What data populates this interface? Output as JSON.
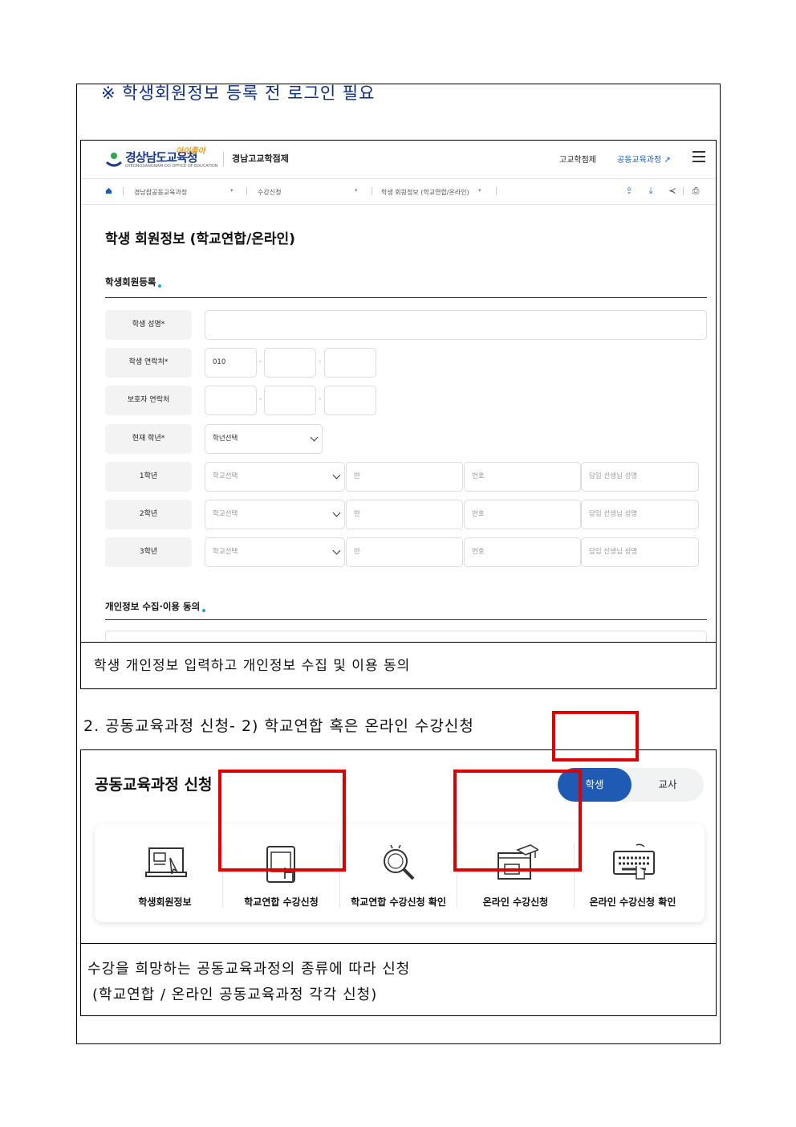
{
  "notice": "※ 학생회원정보 등록 전 로그인 필요",
  "screenshot1": {
    "logo_text": "경상남도교육청",
    "logo_sub": "GYEONGSANGNAM-DO OFFICE OF EDUCATION",
    "logo_tag": "아이좋아",
    "site_name": "경남고교학점제",
    "gnb": [
      "고교학점제",
      "공동교육과정"
    ],
    "breadcrumb": [
      "경남참공동교육과정",
      "수강신청",
      "학생 회원정보 (학교연합/온라인)"
    ],
    "page_title": "학생 회원정보 (학교연합/온라인)",
    "section_register": "학생회원등록",
    "section_privacy": "개인정보 수집·이용 동의",
    "form": {
      "name_label": "학생 성명*",
      "phone_label": "학생 연락처*",
      "phone_prefix": "010",
      "guardian_label": "보호자 연락처",
      "grade_label": "현재 학년*",
      "grade_select": "학년선택",
      "dash": "-",
      "rows": [
        {
          "label": "1학년",
          "school": "학교선택",
          "class": "반",
          "number": "번호",
          "teacher": "담임 선생님 성명"
        },
        {
          "label": "2학년",
          "school": "학교선택",
          "class": "반",
          "number": "번호",
          "teacher": "담임 선생님 성명"
        },
        {
          "label": "3학년",
          "school": "학교선택",
          "class": "반",
          "number": "번호",
          "teacher": "담임 선생님 성명"
        }
      ]
    }
  },
  "caption1": "학생 개인정보 입력하고 개인정보 수집 및 이용 동의",
  "heading2": "2. 공동교육과정 신청- 2) 학교연합 혹은 온라인 수강신청",
  "screenshot2": {
    "title": "공동교육과정 신청",
    "toggle_student": "학생",
    "toggle_teacher": "교사",
    "items": [
      "학생회원정보",
      "학교연합 수강신청",
      "학교연합 수강신청 확인",
      "온라인 수강신청",
      "온라인 수강신청 확인"
    ]
  },
  "caption2_line1": "수강을 희망하는 공동교육과정의 종류에 따라 신청",
  "caption2_line2": "(학교연합 / 온라인 공동교육과정 각각 신청)",
  "colors": {
    "accent": "#1f5bb5",
    "highlight": "#e00000",
    "notice": "#0b2d8a"
  }
}
